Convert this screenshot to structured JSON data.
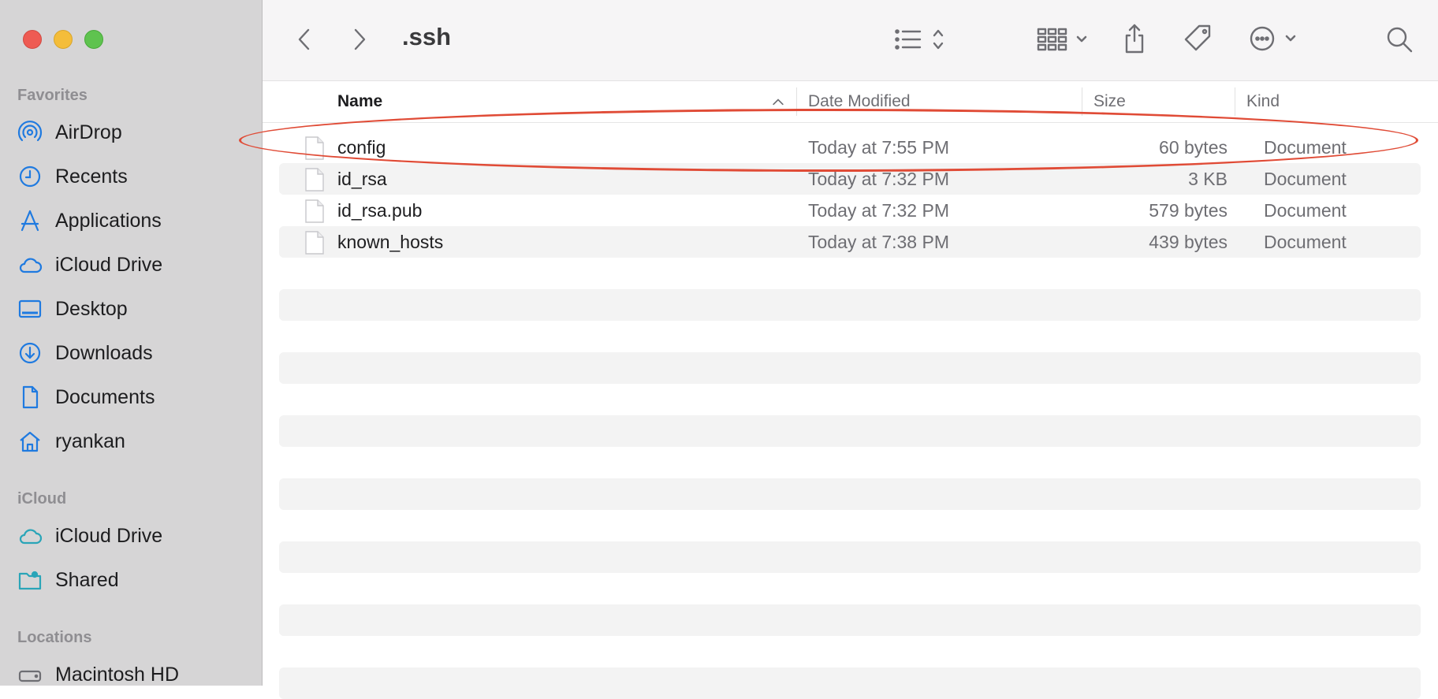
{
  "sidebar": {
    "favorites_label": "Favorites",
    "favorites": [
      {
        "label": "AirDrop",
        "icon": "airdrop-icon"
      },
      {
        "label": "Recents",
        "icon": "clock-icon"
      },
      {
        "label": "Applications",
        "icon": "applications-icon"
      },
      {
        "label": "iCloud Drive",
        "icon": "cloud-icon"
      },
      {
        "label": "Desktop",
        "icon": "desktop-icon"
      },
      {
        "label": "Downloads",
        "icon": "download-icon"
      },
      {
        "label": "Documents",
        "icon": "document-icon"
      },
      {
        "label": "ryankan",
        "icon": "home-icon"
      }
    ],
    "icloud_label": "iCloud",
    "icloud": [
      {
        "label": "iCloud Drive",
        "icon": "cloud-icon"
      },
      {
        "label": "Shared",
        "icon": "shared-folder-icon"
      }
    ],
    "locations_label": "Locations",
    "locations": [
      {
        "label": "Macintosh HD",
        "icon": "disk-icon"
      }
    ]
  },
  "toolbar": {
    "title": ".ssh",
    "buttons": [
      "back-icon",
      "forward-icon",
      "list-view-icon",
      "group-grid-icon",
      "share-icon",
      "tag-icon",
      "more-icon",
      "search-icon"
    ]
  },
  "columns": {
    "name": "Name",
    "date": "Date Modified",
    "size": "Size",
    "kind": "Kind",
    "sort_column": "Name",
    "sort_direction": "ascending"
  },
  "files": [
    {
      "name": "config",
      "date": "Today at 7:55 PM",
      "size": "60 bytes",
      "kind": "Document"
    },
    {
      "name": "id_rsa",
      "date": "Today at 7:32 PM",
      "size": "3 KB",
      "kind": "Document"
    },
    {
      "name": "id_rsa.pub",
      "date": "Today at 7:32 PM",
      "size": "579 bytes",
      "kind": "Document"
    },
    {
      "name": "known_hosts",
      "date": "Today at 7:38 PM",
      "size": "439 bytes",
      "kind": "Document"
    }
  ],
  "colors": {
    "accent": "#1f7ae0",
    "annotation": "#e04b36",
    "sidebar_bg": "#d6d5d6"
  }
}
